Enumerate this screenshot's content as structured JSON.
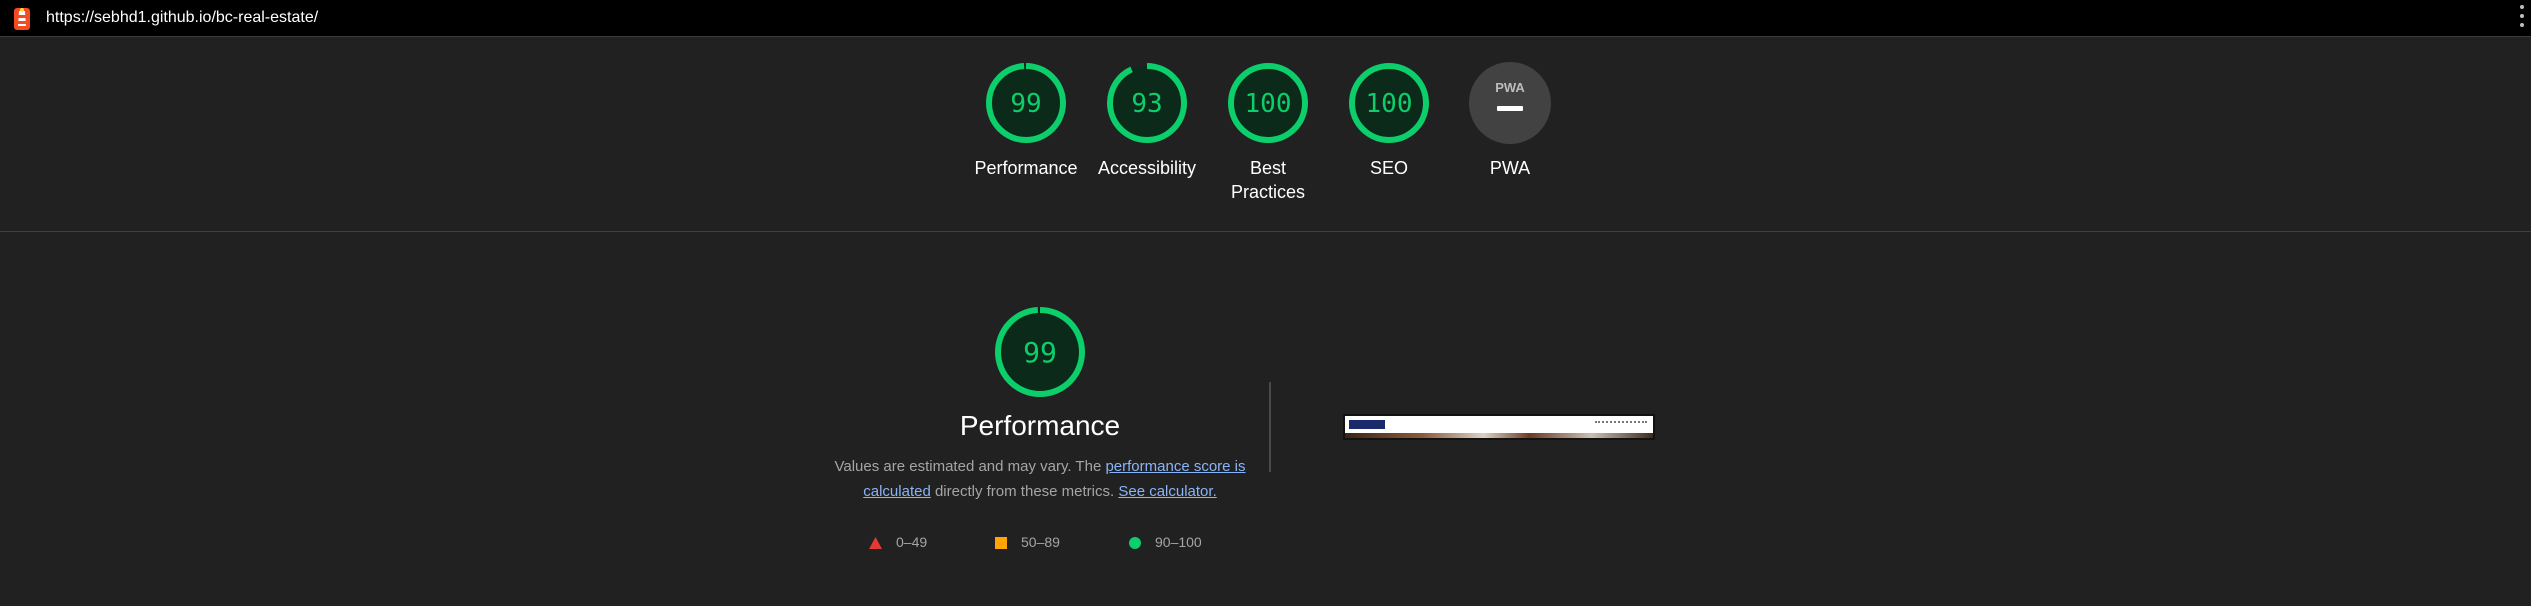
{
  "address_bar": {
    "url": "https://sebhd1.github.io/bc-real-estate/"
  },
  "gauges": [
    {
      "id": "performance",
      "score": "99",
      "value": 99,
      "label": "Performance"
    },
    {
      "id": "accessibility",
      "score": "93",
      "value": 93,
      "label": "Accessibility"
    },
    {
      "id": "best-practices",
      "score": "100",
      "value": 100,
      "label_line1": "Best",
      "label_line2": "Practices"
    },
    {
      "id": "seo",
      "score": "100",
      "value": 100,
      "label": "SEO"
    },
    {
      "id": "pwa",
      "badge": "PWA",
      "label": "PWA"
    }
  ],
  "performance": {
    "score": "99",
    "value": 99,
    "title": "Performance",
    "desc_prefix": "Values are estimated and may vary. The ",
    "desc_link1": "performance score is calculated",
    "desc_middle": " directly from these metrics. ",
    "desc_link2": "See calculator."
  },
  "legend": [
    {
      "range": "0–49",
      "shape": "triangle",
      "color": "#e53935"
    },
    {
      "range": "50–89",
      "shape": "square",
      "color": "#ffa400"
    },
    {
      "range": "90–100",
      "shape": "circle",
      "color": "#0cce6b"
    }
  ],
  "colors": {
    "pass": "#0cce6b",
    "pass_fill": "#0c2a1a",
    "pwa_fill": "#424242",
    "background": "#212121",
    "link": "#8ab4f8"
  }
}
